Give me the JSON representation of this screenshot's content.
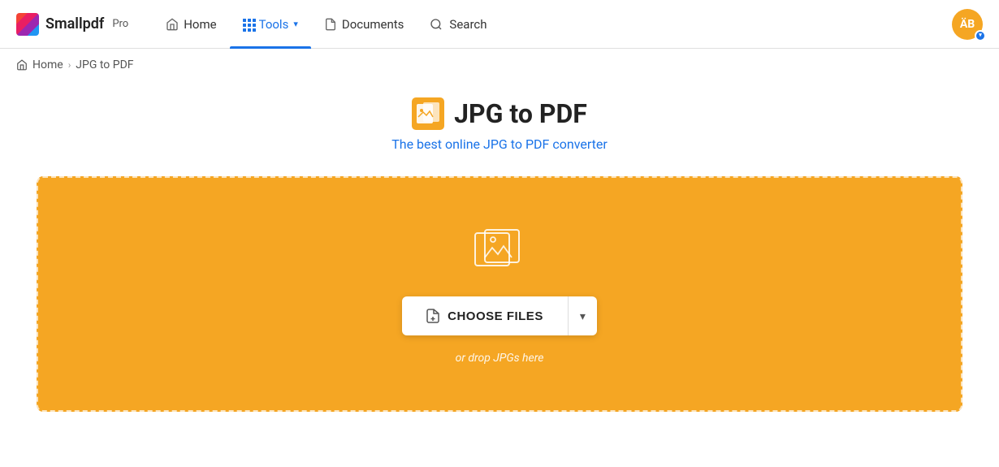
{
  "brand": {
    "name": "Smallpdf",
    "pro_label": "Pro"
  },
  "nav": {
    "home_label": "Home",
    "tools_label": "Tools",
    "documents_label": "Documents",
    "search_label": "Search"
  },
  "avatar": {
    "initials": "ÄB"
  },
  "breadcrumb": {
    "home": "Home",
    "current": "JPG to PDF"
  },
  "page": {
    "title": "JPG to PDF",
    "subtitle": "The best online JPG to PDF converter"
  },
  "dropzone": {
    "choose_files_label": "CHOOSE FILES",
    "drop_hint": "or drop JPGs here"
  }
}
